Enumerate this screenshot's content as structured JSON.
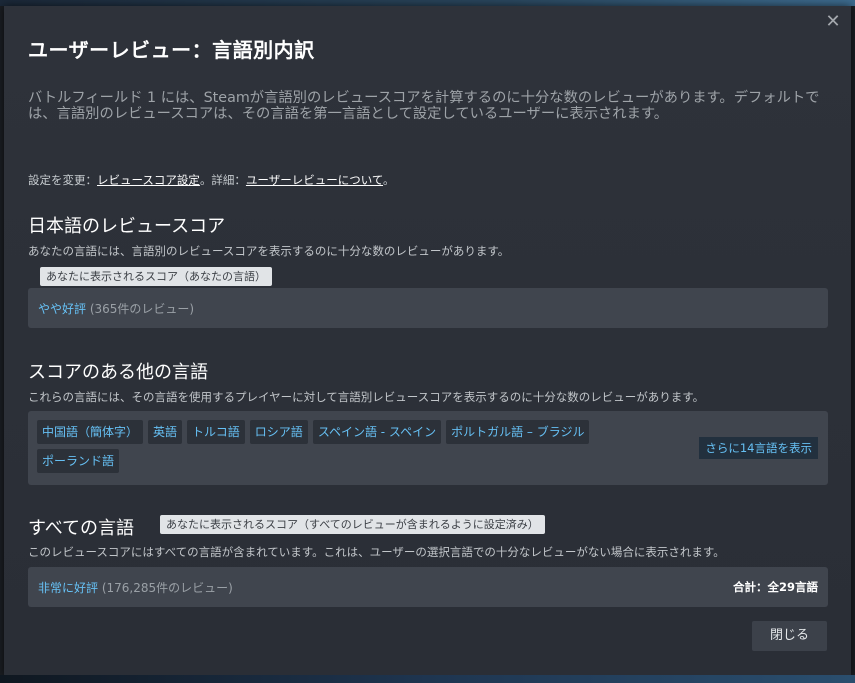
{
  "dialog": {
    "title": "ユーザーレビュー：言語別内訳",
    "intro": "バトルフィールド 1 には、Steamが言語別のレビュースコアを計算するのに十分な数のレビューがあります。デフォルトでは、言語別のレビュースコアは、その言語を第一言語として設定しているユーザーに表示されます。",
    "settings_prefix": "設定を変更：",
    "settings_link": "レビュースコア設定",
    "details_prefix": "。詳細：",
    "details_link": "ユーザーレビューについて",
    "details_suffix": "。",
    "close_label": "閉じる"
  },
  "japanese_section": {
    "title": "日本語のレビュースコア",
    "description": "あなたの言語には、言語別のレビュースコアを表示するのに十分な数のレビューがあります。",
    "tag": "あなたに表示されるスコア（あなたの言語）",
    "rating": "やや好評",
    "count": " (365件のレビュー)"
  },
  "other_section": {
    "title": "スコアのある他の言語",
    "description": "これらの言語には、その言語を使用するプレイヤーに対して言語別レビュースコアを表示するのに十分な数のレビューがあります。",
    "languages": [
      "中国語（簡体字）",
      "英語",
      "トルコ語",
      "ロシア語",
      "スペイン語 - スペイン",
      "ポルトガル語 – ブラジル",
      "ポーランド語"
    ],
    "more_label": "さらに14言語を表示"
  },
  "all_section": {
    "title": "すべての言語",
    "tag": "あなたに表示されるスコア（すべてのレビューが含まれるように設定済み）",
    "description": "このレビュースコアにはすべての言語が含まれています。これは、ユーザーの選択言語での十分なレビューがない場合に表示されます。",
    "rating": "非常に好評",
    "count": " (176,285件のレビュー)",
    "total": "合計：全29言語"
  },
  "colors": {
    "accent": "#66c0f4",
    "modal_bg": "#2e323a",
    "box_bg": "#40454e"
  }
}
